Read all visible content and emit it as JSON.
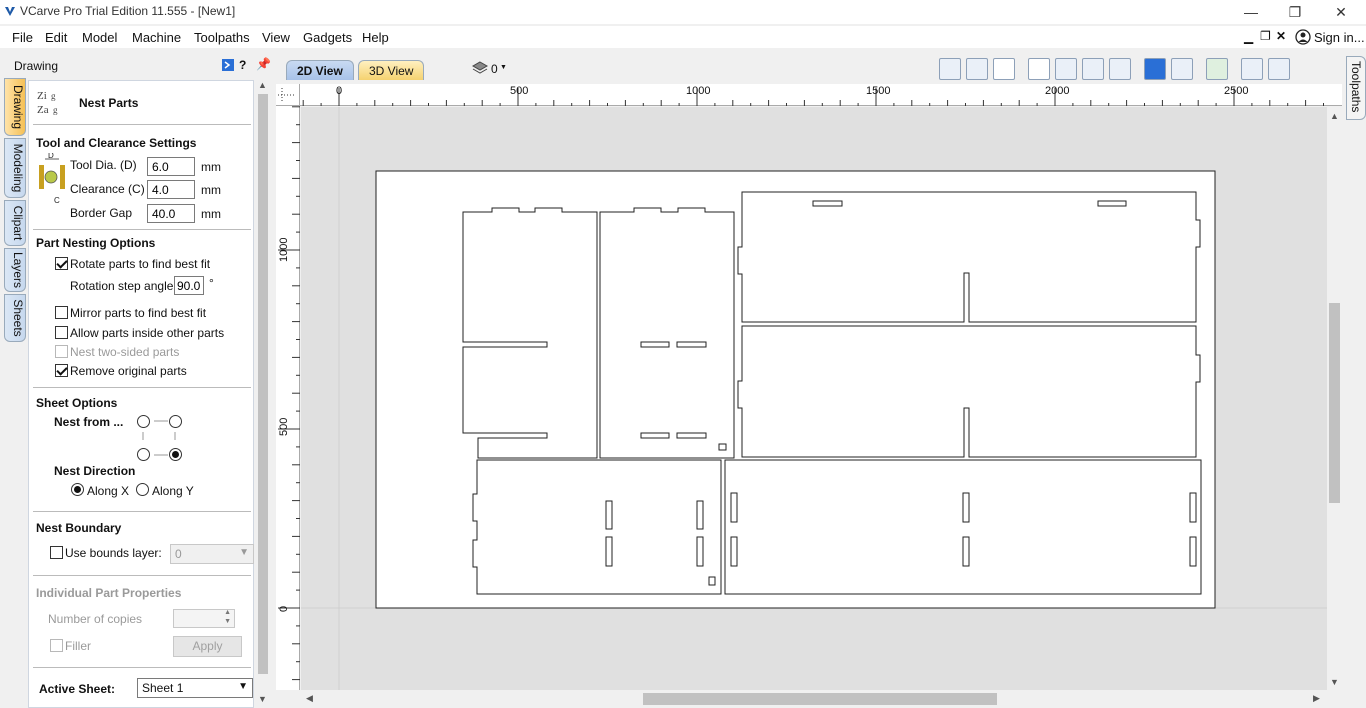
{
  "window": {
    "title": "VCarve Pro Trial Edition 11.555 - [New1]",
    "minimize_glyph": "—",
    "restore_glyph": "❐",
    "close_glyph": "✕"
  },
  "menu": {
    "items": [
      "File",
      "Edit",
      "Model",
      "Machine",
      "Toolpaths",
      "View",
      "Gadgets",
      "Help"
    ],
    "sign_in": "Sign in..."
  },
  "left_panel": {
    "header": "Drawing",
    "help_glyph": "?",
    "vertical_tabs": [
      "Drawing",
      "Modeling",
      "Clipart",
      "Layers",
      "Sheets"
    ],
    "title": "Nest Parts",
    "logo_text": "Zig Zag",
    "tool_section": {
      "heading": "Tool and Clearance Settings",
      "diagram_d": "D",
      "diagram_c": "C",
      "tool_dia_label": "Tool Dia. (D)",
      "tool_dia_value": "6.0",
      "clearance_label": "Clearance (C)",
      "clearance_value": "4.0",
      "border_gap_label": "Border Gap",
      "border_gap_value": "40.0",
      "unit": "mm"
    },
    "nesting_section": {
      "heading": "Part Nesting Options",
      "rotate_label": "Rotate parts to find best fit",
      "rotate_checked": true,
      "rotation_step_label": "Rotation step angle",
      "rotation_step_value": "90.0",
      "degree": "°",
      "mirror_label": "Mirror parts to find best fit",
      "mirror_checked": false,
      "inside_label": "Allow parts inside other parts",
      "inside_checked": false,
      "two_sided_label": "Nest two-sided parts",
      "two_sided_checked": false,
      "remove_label": "Remove original parts",
      "remove_checked": true
    },
    "sheet_section": {
      "heading": "Sheet Options",
      "nest_from_label": "Nest from ...",
      "nest_from_selected": "bottom-right",
      "direction_label": "Nest Direction",
      "along_x_label": "Along X",
      "along_y_label": "Along Y",
      "direction_selected": "x"
    },
    "boundary_section": {
      "heading": "Nest Boundary",
      "use_bounds_label": "Use bounds layer:",
      "use_bounds_checked": false,
      "bounds_value": "0"
    },
    "individual_section": {
      "heading": "Individual Part Properties",
      "copies_label": "Number of copies",
      "filler_label": "Filler",
      "apply_label": "Apply"
    },
    "active_sheet": {
      "label": "Active Sheet:",
      "value": "Sheet 1"
    }
  },
  "view": {
    "tab_2d": "2D View",
    "tab_3d": "3D View",
    "layer_value": "0",
    "right_tab": "Toolpaths",
    "ruler_x_labels": [
      "0",
      "500",
      "1000",
      "1500",
      "2000",
      "2500"
    ],
    "ruler_y_labels": [
      "1000",
      "500",
      "0"
    ]
  },
  "colors": {
    "accent_tab": "#f5c055",
    "panel_border": "#cfd6e0",
    "canvas_bg": "#e0e0e0"
  }
}
